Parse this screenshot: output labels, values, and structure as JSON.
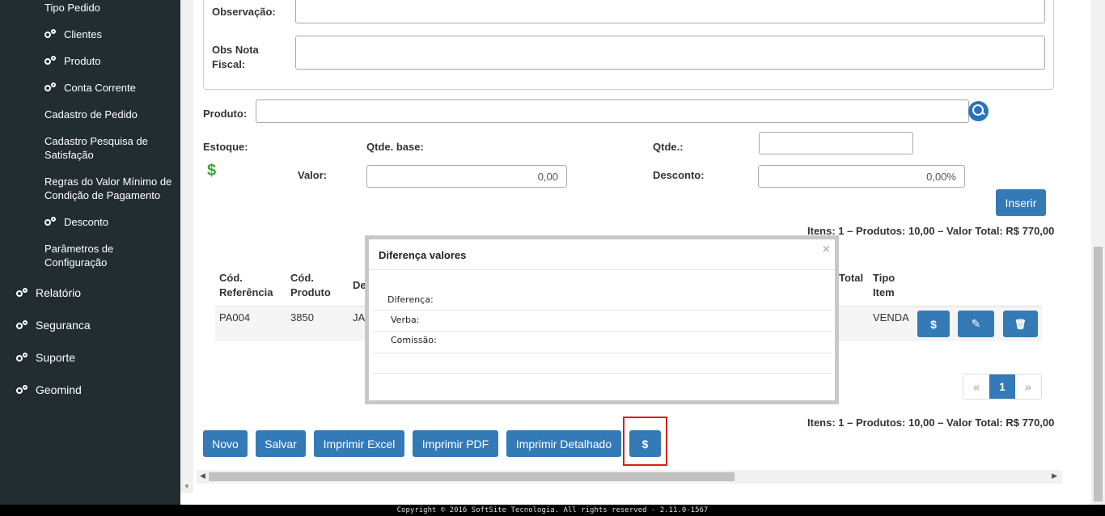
{
  "sidebar": {
    "items": [
      {
        "label": "Tipo Pedido",
        "icon": ""
      },
      {
        "label": "Clientes",
        "icon": "gears-icon"
      },
      {
        "label": "Produto",
        "icon": "gears-icon"
      },
      {
        "label": "Conta Corrente",
        "icon": "gears-icon"
      },
      {
        "label": "Cadastro de Pedido",
        "icon": ""
      },
      {
        "label": "Cadastro Pesquisa de Satisfação",
        "icon": ""
      },
      {
        "label": "Regras do Valor Mínimo de Condição de Pagamento",
        "icon": ""
      },
      {
        "label": "Desconto",
        "icon": "gears-icon"
      },
      {
        "label": "Parâmetros de Configuração",
        "icon": ""
      }
    ],
    "sections": [
      {
        "label": "Relatório"
      },
      {
        "label": "Seguranca"
      },
      {
        "label": "Suporte"
      },
      {
        "label": "Geomind"
      }
    ]
  },
  "form": {
    "observacao_label": "Observação:",
    "obs_nota_label": "Obs Nota Fiscal:",
    "produto_label": "Produto:",
    "estoque_label": "Estoque:",
    "qtde_base_label": "Qtde. base:",
    "qtde_label": "Qtde.:",
    "valor_label": "Valor:",
    "valor_value": "0,00",
    "desconto_label": "Desconto:",
    "desconto_value": "0,00%",
    "inserir_label": "Inserir",
    "estoque_icon_glyph": "$"
  },
  "summary_top": "Itens: 1 – Produtos: 10,00 – Valor Total: R$ 770,00",
  "summary_bottom": "Itens: 1 – Produtos: 10,00 – Valor Total: R$ 770,00",
  "table": {
    "headers": {
      "cod_ref": "Cód. Referência",
      "cod_prod": "Cód. Produto",
      "desc_partial": "De",
      "total_partial": "Total",
      "tipo_item": "Tipo Item"
    },
    "rows": [
      {
        "cod_ref": "PA004",
        "cod_prod": "3850",
        "desc_partial": "JA",
        "tipo_item": "VENDA"
      }
    ],
    "row_buttons": {
      "dollar": "$",
      "edit": "✎",
      "delete": "🗑"
    }
  },
  "pagination": {
    "prev": "«",
    "current": "1",
    "next": "»"
  },
  "actions": {
    "novo": "Novo",
    "salvar": "Salvar",
    "imprimir_excel": "Imprimir Excel",
    "imprimir_pdf": "Imprimir PDF",
    "imprimir_detalhado": "Imprimir Detalhado",
    "dollar": "$"
  },
  "modal": {
    "title": "Diferença valores",
    "close": "×",
    "diferenca_label": "Diferença:",
    "verba_label": "Verba:",
    "comissao_label": "Comissão:"
  },
  "footer": "Copyright © 2016 SoftSite Tecnologia. All rights reserved - 2.11.0-1567",
  "colors": {
    "primary": "#337ab7",
    "sidebar": "#222d32",
    "highlight": "#d62020",
    "dollar_green": "#3aa53a"
  }
}
